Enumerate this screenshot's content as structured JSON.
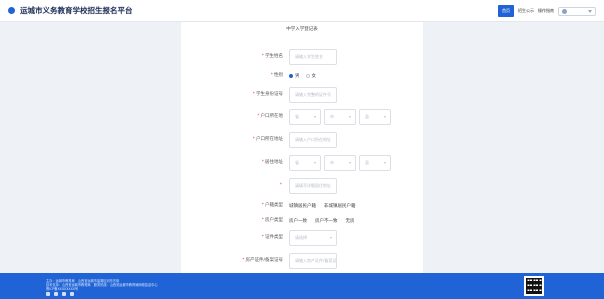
{
  "header": {
    "title": "运城市义务教育学校招生报名平台",
    "nav": {
      "home": "首页",
      "link1": "招生公示",
      "link2": "操作指南",
      "user": ""
    }
  },
  "form": {
    "title": "中学入学登记表",
    "fields": {
      "student_name": {
        "label": "学生姓名",
        "placeholder": "请输入学生姓名"
      },
      "gender": {
        "label": "性别",
        "options": [
          "男",
          "女"
        ],
        "selected": "男"
      },
      "student_id": {
        "label": "学生身份证号",
        "placeholder": "请输入完整的证件号"
      },
      "hukou_location": {
        "label": "户口所在地",
        "selects": [
          "省",
          "市",
          "县"
        ]
      },
      "hukou_address": {
        "label": "户口所在地址",
        "placeholder": "请输入户口所在地址"
      },
      "residence_location": {
        "label": "居住地址",
        "selects": [
          "省",
          "市",
          "县"
        ]
      },
      "residence_detail": {
        "label": "",
        "placeholder": "请填写详细居住地址"
      },
      "hukou_type": {
        "label": "户籍类型",
        "options": [
          "城镇居民户籍",
          "非城镇居民户籍"
        ]
      },
      "household_type": {
        "label": "房户类型",
        "options": [
          "房户一致",
          "房户不一致",
          "无房"
        ]
      },
      "property_type": {
        "label": "证件类型",
        "placeholder": "请选择"
      },
      "property_number": {
        "label": "房产证件/备案证号",
        "placeholder": "请输入房产证件/备案证号"
      }
    }
  },
  "footer": {
    "line1": "主办：运城市教育局　山西省运城市盐湖区河东东街",
    "line2": "技术支持：山西省运城市教育局　服务热线：山西省运城市教育局网络信息中心",
    "line3": "晋ICP备XXXXXXXX号"
  }
}
